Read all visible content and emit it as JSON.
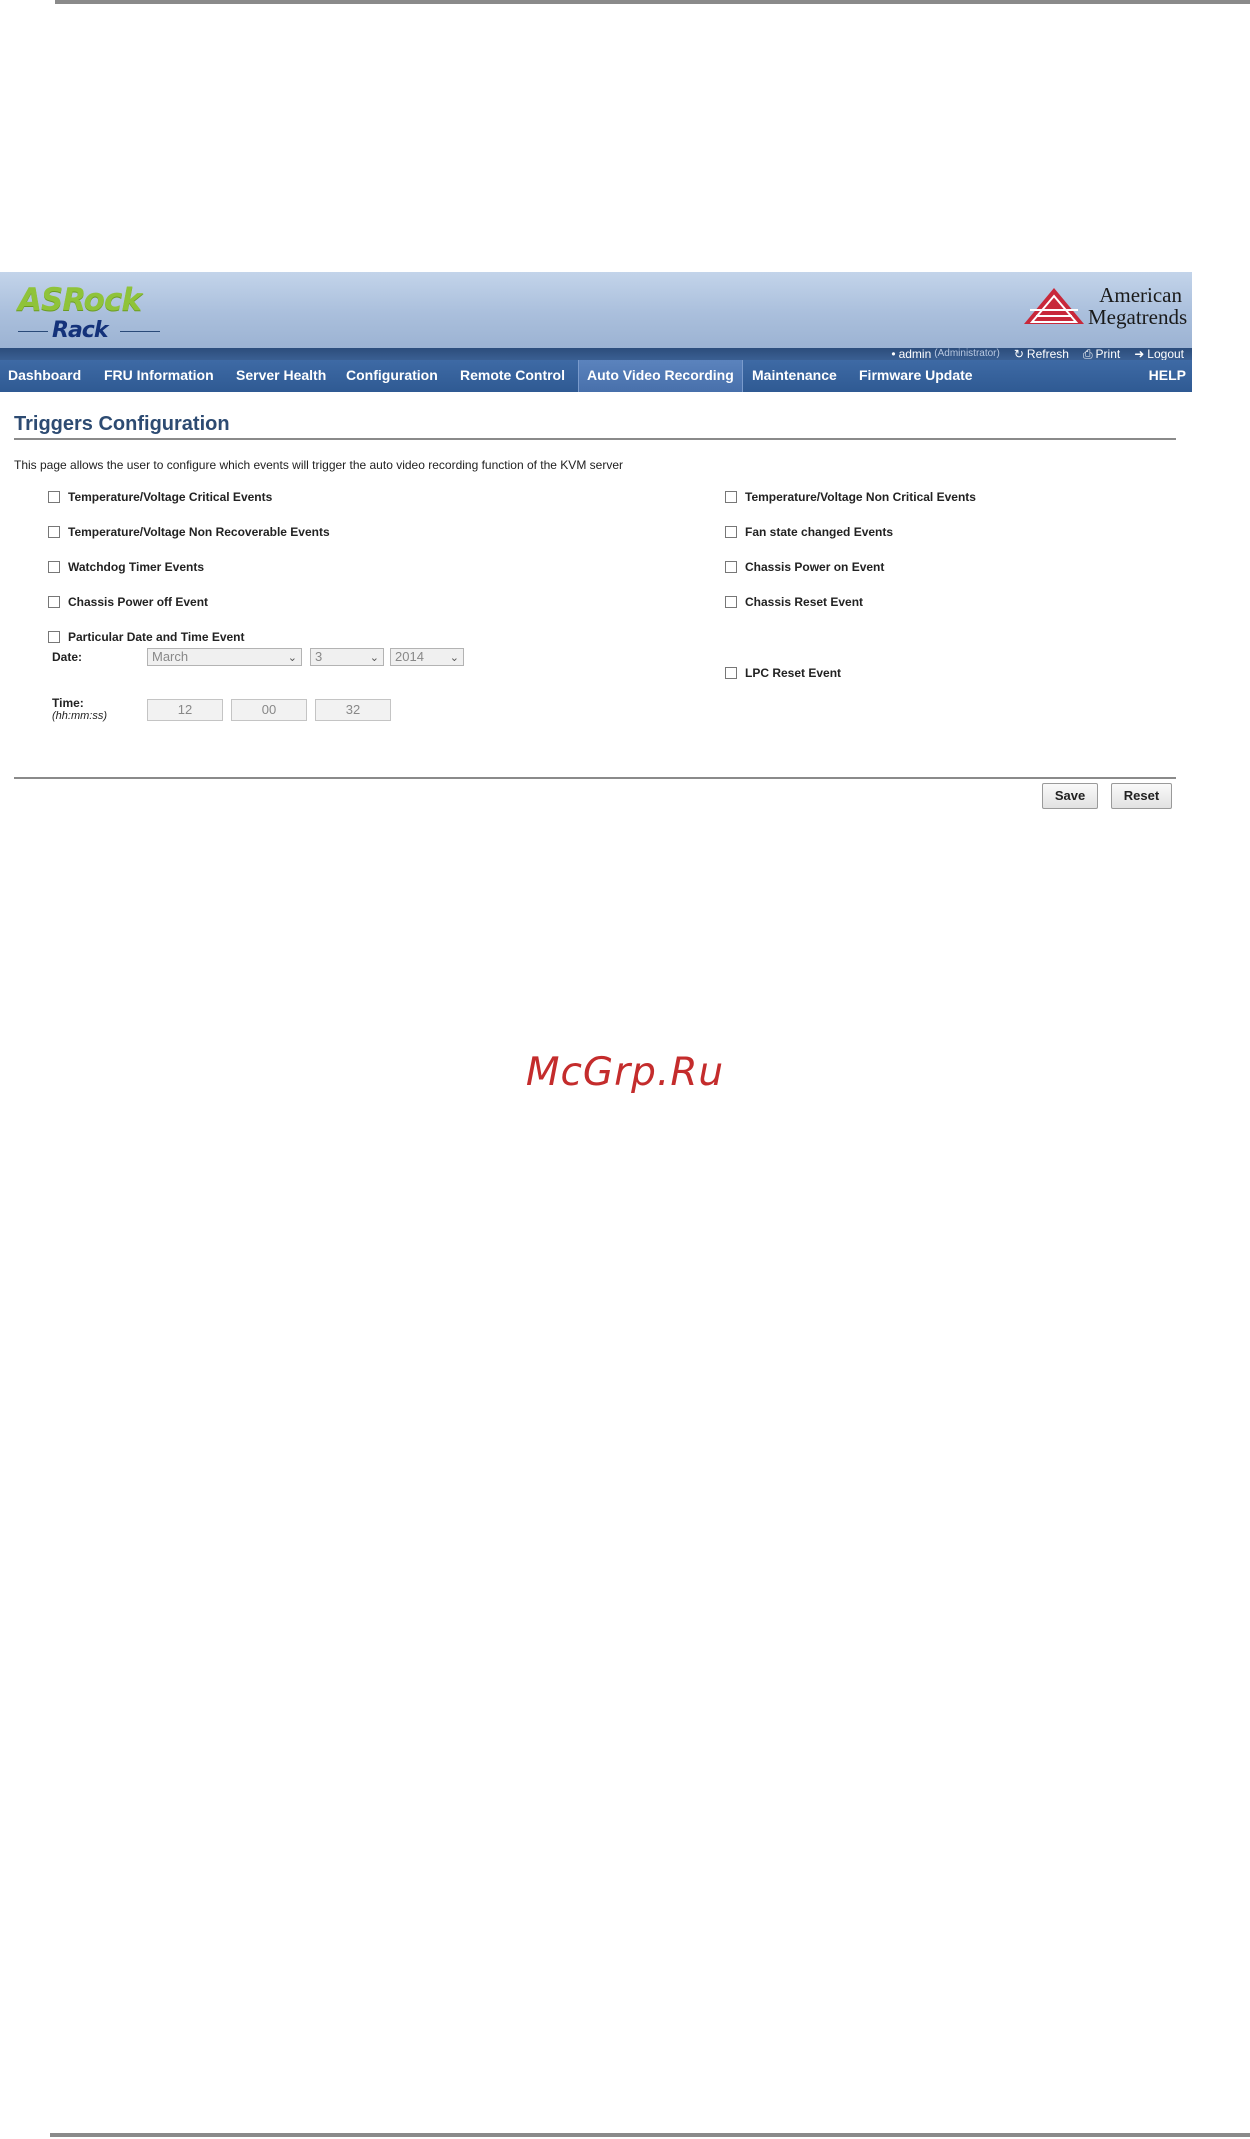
{
  "watermark": "McGrp.Ru",
  "header": {
    "logo_top": "ASRock",
    "logo_bottom": "Rack",
    "vendor_line1": "American",
    "vendor_line2": "Megatrends"
  },
  "status": {
    "user": "admin",
    "role": "(Administrator)",
    "refresh": "Refresh",
    "print": "Print",
    "logout": "Logout"
  },
  "nav": {
    "items": [
      {
        "label": "Dashboard"
      },
      {
        "label": "FRU Information"
      },
      {
        "label": "Server Health"
      },
      {
        "label": "Configuration"
      },
      {
        "label": "Remote Control"
      },
      {
        "label": "Auto Video Recording",
        "active": true
      },
      {
        "label": "Maintenance"
      },
      {
        "label": "Firmware Update"
      }
    ],
    "help": "HELP"
  },
  "main": {
    "title": "Triggers Configuration",
    "description": "This page allows the user to configure which events will trigger the auto video recording function of the KVM server",
    "left_events": [
      {
        "label": "Temperature/Voltage Critical Events",
        "checked": false
      },
      {
        "label": "Temperature/Voltage Non Recoverable Events",
        "checked": false
      },
      {
        "label": "Watchdog Timer Events",
        "checked": false
      },
      {
        "label": "Chassis Power off Event",
        "checked": false
      },
      {
        "label": "Particular Date and Time Event",
        "checked": false
      }
    ],
    "right_events": [
      {
        "label": "Temperature/Voltage Non Critical Events",
        "checked": false
      },
      {
        "label": "Fan state changed Events",
        "checked": false
      },
      {
        "label": "Chassis Power on Event",
        "checked": false
      },
      {
        "label": "Chassis Reset Event",
        "checked": false
      },
      {
        "label": "LPC Reset Event",
        "checked": false
      }
    ],
    "date": {
      "label": "Date:",
      "month": "March",
      "day": "3",
      "year": "2014"
    },
    "time": {
      "label": "Time:",
      "format_hint": "(hh:mm:ss)",
      "hh": "12",
      "mm": "00",
      "ss": "32"
    },
    "save_label": "Save",
    "reset_label": "Reset"
  }
}
